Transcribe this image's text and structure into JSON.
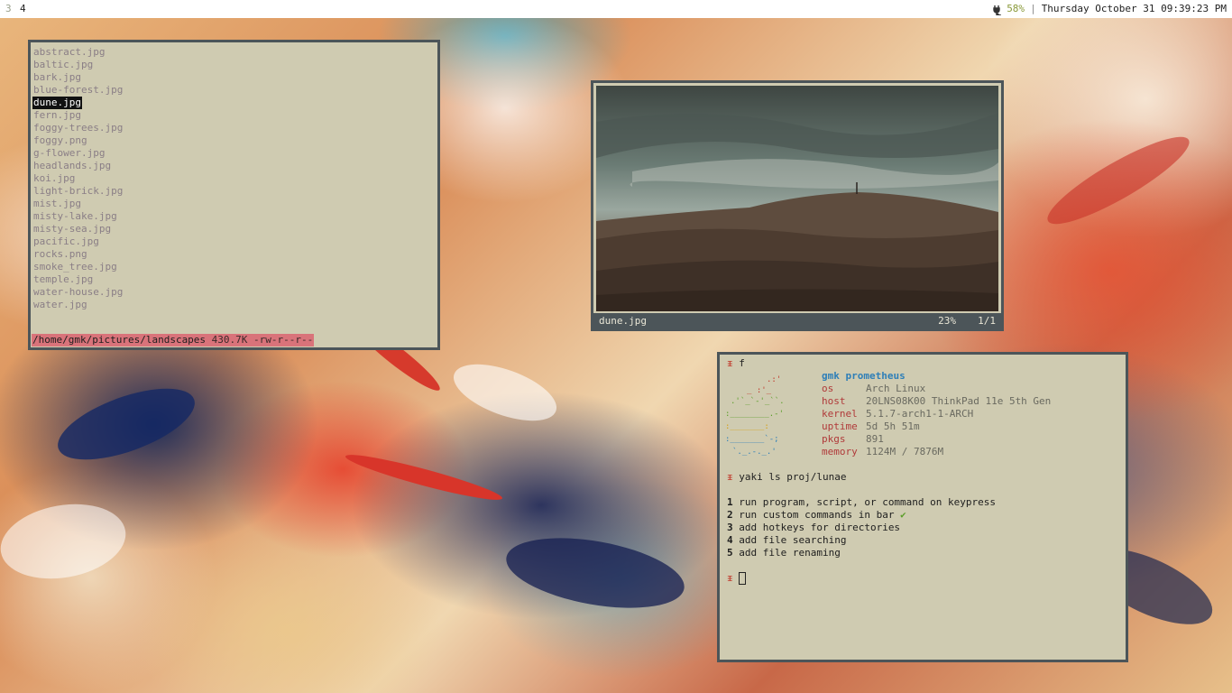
{
  "topbar": {
    "workspaces": [
      "3",
      "4"
    ],
    "battery": "58%",
    "separator": "|",
    "clock": "Thursday October 31 09:39:23 PM"
  },
  "filelist": {
    "files": [
      "abstract.jpg",
      "baltic.jpg",
      "bark.jpg",
      "blue-forest.jpg",
      "dune.jpg",
      "fern.jpg",
      "foggy-trees.jpg",
      "foggy.png",
      "g-flower.jpg",
      "headlands.jpg",
      "koi.jpg",
      "light-brick.jpg",
      "mist.jpg",
      "misty-lake.jpg",
      "misty-sea.jpg",
      "pacific.jpg",
      "rocks.png",
      "smoke_tree.jpg",
      "temple.jpg",
      "water-house.jpg",
      "water.jpg"
    ],
    "selected": "dune.jpg",
    "status_path": "/home/gmk/pictures/landscapes",
    "status_info": " 430.7K -rw-r--r--"
  },
  "viewer": {
    "filename": "dune.jpg",
    "zoom": "23%",
    "count": "1/1"
  },
  "terminal": {
    "prompt_glyph": "ᵻ",
    "cmd1": "f",
    "user_host": "gmk prometheus",
    "info": [
      {
        "key": "os",
        "val": "Arch Linux"
      },
      {
        "key": "host",
        "val": "20LNS08K00 ThinkPad 11e 5th Gen"
      },
      {
        "key": "kernel",
        "val": "5.1.7-arch1-1-ARCH"
      },
      {
        "key": "uptime",
        "val": "5d 5h 51m"
      },
      {
        "key": "pkgs",
        "val": "891"
      },
      {
        "key": "memory",
        "val": "1124M / 7876M"
      }
    ],
    "cmd2": "yaki ls proj/lunae",
    "todos": [
      {
        "num": "1",
        "text": "run program, script, or command on keypress",
        "done": false
      },
      {
        "num": "2",
        "text": "run custom commands in bar",
        "done": true
      },
      {
        "num": "3",
        "text": "add hotkeys for directories",
        "done": false
      },
      {
        "num": "4",
        "text": "add file searching",
        "done": false
      },
      {
        "num": "5",
        "text": "add file renaming",
        "done": false
      }
    ],
    "check_glyph": "✔"
  },
  "colors": {
    "window_bg": "#cfcbb1",
    "border": "#4c5559",
    "accent_red": "#b03a3a",
    "accent_blue": "#2e7fb8",
    "status_pink": "#d9737a"
  }
}
